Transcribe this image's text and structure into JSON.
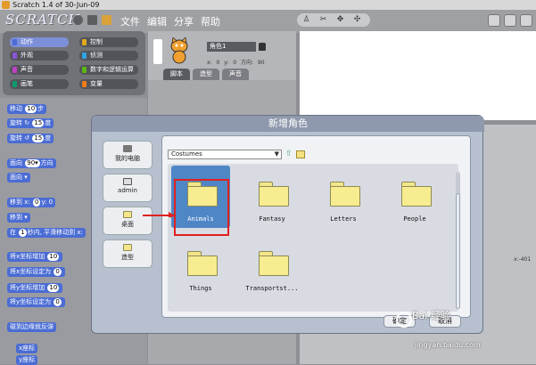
{
  "window": {
    "title": "Scratch 1.4 of 30-Jun-09"
  },
  "menubar": {
    "logo": "SCRATCH",
    "menus": [
      "文件",
      "编辑",
      "分享",
      "帮助"
    ]
  },
  "categories": [
    {
      "label": "动作",
      "color": "#4a6cd4",
      "active": true
    },
    {
      "label": "控制",
      "color": "#e1a91a"
    },
    {
      "label": "外观",
      "color": "#8a55d7"
    },
    {
      "label": "侦测",
      "color": "#2ca5e2"
    },
    {
      "label": "声音",
      "color": "#bb42c3"
    },
    {
      "label": "数字和逻辑运算",
      "color": "#5cb712"
    },
    {
      "label": "画笔",
      "color": "#0e9a6c"
    },
    {
      "label": "变量",
      "color": "#ee7d16"
    }
  ],
  "palette": {
    "blocks": [
      {
        "label": "移动",
        "num": "10",
        "suffix": "步"
      },
      {
        "label": "旋转 ↻",
        "num": "15",
        "suffix": "度"
      },
      {
        "label": "旋转 ↺",
        "num": "15",
        "suffix": "度"
      },
      {
        "label": "面向",
        "num": "90▾",
        "suffix": "方向"
      },
      {
        "label": "面向",
        "num": "",
        "suffix": "▾"
      },
      {
        "label": "移到 x:",
        "num": "0",
        "suffix": "y: 0"
      },
      {
        "label": "移到",
        "num": "",
        "suffix": "▾"
      },
      {
        "label": "在",
        "num": "1",
        "suffix": "秒内, 平滑移动到 x:"
      },
      {
        "label": "将x坐标增加",
        "num": "10",
        "suffix": ""
      },
      {
        "label": "将x坐标设定为",
        "num": "0",
        "suffix": ""
      },
      {
        "label": "将y坐标增加",
        "num": "10",
        "suffix": ""
      },
      {
        "label": "将y坐标设定为",
        "num": "0",
        "suffix": ""
      },
      {
        "label": "碰到边缘就反弹",
        "num": "",
        "suffix": ""
      },
      {
        "label": "x座标",
        "num": "",
        "suffix": ""
      },
      {
        "label": "y座标",
        "num": "",
        "suffix": ""
      }
    ]
  },
  "sprite": {
    "name": "角色1",
    "coords": "x: 0   y: 0   方向: 90",
    "tabs": [
      "脚本",
      "造型",
      "声音"
    ]
  },
  "stage": {
    "xy": "x:-401"
  },
  "dialog": {
    "title": "新增角色",
    "places": [
      "我的电脑",
      "admin",
      "桌面",
      "造型"
    ],
    "path": "Costumes",
    "folders": [
      "Animals",
      "Fantasy",
      "Letters",
      "People",
      "Things",
      "Transportst..."
    ],
    "selected": "Animals",
    "ok_label": "确定",
    "cancel_label": "取消"
  },
  "watermark": {
    "line1": "Bai 经验",
    "line2": "jingyan.baidu.com"
  }
}
